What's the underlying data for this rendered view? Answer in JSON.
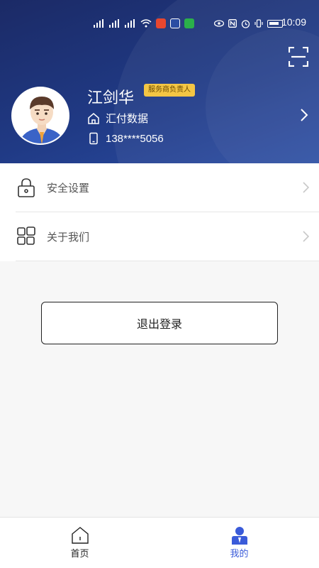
{
  "status_bar": {
    "time": "10:09"
  },
  "profile": {
    "name": "江剑华",
    "role_badge": "服务商负责人",
    "company": "汇付数据",
    "phone": "138****5056"
  },
  "menu": {
    "items": [
      {
        "label": "安全设置",
        "icon": "lock-icon"
      },
      {
        "label": "关于我们",
        "icon": "grid-icon"
      }
    ]
  },
  "logout": {
    "label": "退出登录"
  },
  "tabbar": {
    "tabs": [
      {
        "label": "首页",
        "icon": "home-icon",
        "active": false
      },
      {
        "label": "我的",
        "icon": "user-icon",
        "active": true
      }
    ]
  },
  "colors": {
    "header_start": "#1b2a66",
    "header_end": "#2b4da3",
    "badge": "#f4c644",
    "active_tab": "#3a5bd9"
  }
}
